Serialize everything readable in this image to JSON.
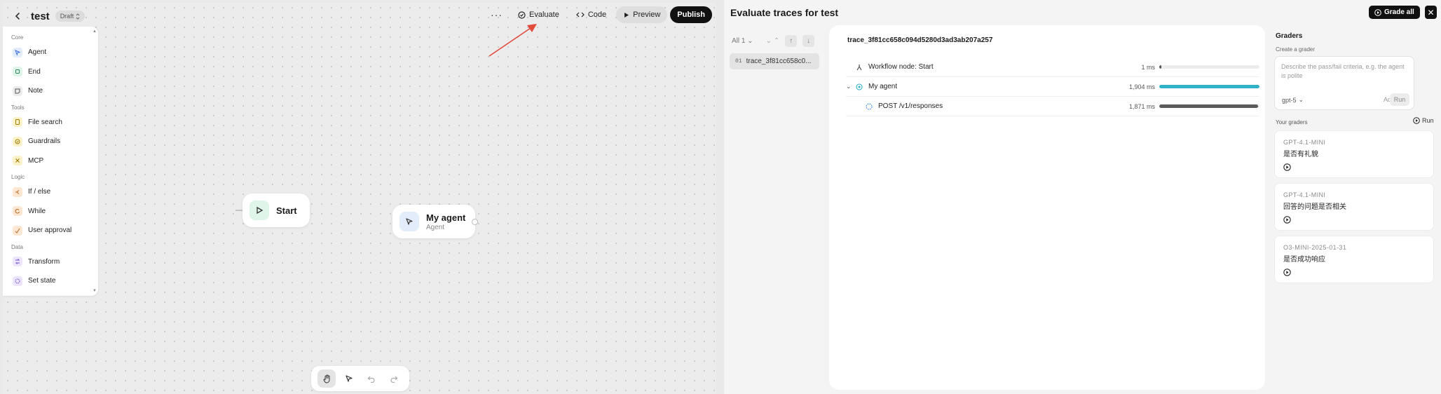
{
  "editor": {
    "title": "test",
    "status": "Draft",
    "toolbar": {
      "more": "···",
      "evaluate": "Evaluate",
      "code": "Code",
      "preview": "Preview",
      "publish": "Publish"
    },
    "palette": {
      "sections": [
        {
          "label": "Core",
          "items": [
            {
              "label": "Agent",
              "icon": "agent-icon",
              "color": "#e3ecfb"
            },
            {
              "label": "End",
              "icon": "end-icon",
              "color": "#dff5ea"
            },
            {
              "label": "Note",
              "icon": "note-icon",
              "color": "#ececec"
            }
          ]
        },
        {
          "label": "Tools",
          "items": [
            {
              "label": "File search",
              "icon": "file-search-icon",
              "color": "#fbf2c9"
            },
            {
              "label": "Guardrails",
              "icon": "guardrails-icon",
              "color": "#fbf2c9"
            },
            {
              "label": "MCP",
              "icon": "mcp-icon",
              "color": "#fbf2c9"
            }
          ]
        },
        {
          "label": "Logic",
          "items": [
            {
              "label": "If / else",
              "icon": "branch-icon",
              "color": "#fde6d2"
            },
            {
              "label": "While",
              "icon": "loop-icon",
              "color": "#fde6d2"
            },
            {
              "label": "User approval",
              "icon": "approval-icon",
              "color": "#fde6d2"
            }
          ]
        },
        {
          "label": "Data",
          "items": [
            {
              "label": "Transform",
              "icon": "transform-icon",
              "color": "#ece5fb"
            },
            {
              "label": "Set state",
              "icon": "set-state-icon",
              "color": "#ece5fb"
            }
          ]
        }
      ]
    },
    "nodes": {
      "start": {
        "title": "Start"
      },
      "agent": {
        "title": "My agent",
        "subtitle": "Agent"
      }
    }
  },
  "evaluate": {
    "title": "Evaluate traces for test",
    "grade_all": "Grade all",
    "filter": "All 1",
    "trace_list": [
      {
        "index": "01",
        "label": "trace_3f81cc658c0..."
      }
    ],
    "trace": {
      "id": "trace_3f81cc658c094d5280d3ad3ab207a257",
      "spans": [
        {
          "name": "Workflow node: Start",
          "duration": "1 ms",
          "fraction": 0.02,
          "color": "#555555"
        },
        {
          "name": "My agent",
          "duration": "1,904 ms",
          "fraction": 1.0,
          "color": "#2fb1c8"
        },
        {
          "name": "POST /v1/responses",
          "duration": "1,871 ms",
          "fraction": 0.983,
          "color": "#5a5a5a"
        }
      ]
    },
    "graders": {
      "title": "Graders",
      "create_label": "Create a grader",
      "placeholder": "Describe the pass/fail criteria, e.g. the agent is polite",
      "model": "gpt-5",
      "add": "Add",
      "run": "Run",
      "yours_label": "Your graders",
      "yours_run": "Run",
      "list": [
        {
          "model": "GPT-4.1-MINI",
          "name": "是否有礼貌"
        },
        {
          "model": "GPT-4.1-MINI",
          "name": "回答的问题是否相关"
        },
        {
          "model": "O3-MINI-2025-01-31",
          "name": "是否成功响应"
        }
      ]
    }
  }
}
